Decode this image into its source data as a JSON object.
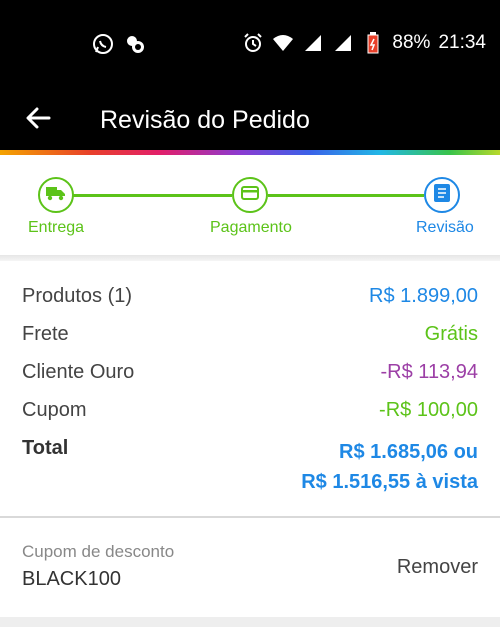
{
  "status_bar": {
    "left_icons": [
      "whatsapp-icon",
      "notification-icon"
    ],
    "battery_percent": "88%",
    "time": "21:34",
    "right_icons": [
      "alarm-icon",
      "wifi-icon",
      "signal-icon",
      "signal-icon",
      "battery-icon"
    ]
  },
  "app_bar": {
    "title": "Revisão do Pedido",
    "back_icon": "arrow-left-icon"
  },
  "stepper": {
    "steps": [
      {
        "label": "Entrega",
        "icon": "truck-icon",
        "state": "done"
      },
      {
        "label": "Pagamento",
        "icon": "credit-card-icon",
        "state": "done"
      },
      {
        "label": "Revisão",
        "icon": "list-icon",
        "state": "active"
      }
    ],
    "colors": {
      "done": "#5cc319",
      "active": "#1e88e5"
    }
  },
  "summary": {
    "rows": [
      {
        "label": "Produtos (1)",
        "value": "R$ 1.899,00"
      },
      {
        "label": "Frete",
        "value": "Grátis"
      },
      {
        "label": "Cliente Ouro",
        "value": "-R$ 113,94"
      },
      {
        "label": "Cupom",
        "value": "-R$ 100,00"
      }
    ],
    "total": {
      "label": "Total",
      "value_line1": "R$ 1.685,06 ou",
      "value_line2": "R$ 1.516,55 à vista"
    }
  },
  "coupon": {
    "label": "Cupom de desconto",
    "code": "BLACK100",
    "remove_label": "Remover"
  }
}
